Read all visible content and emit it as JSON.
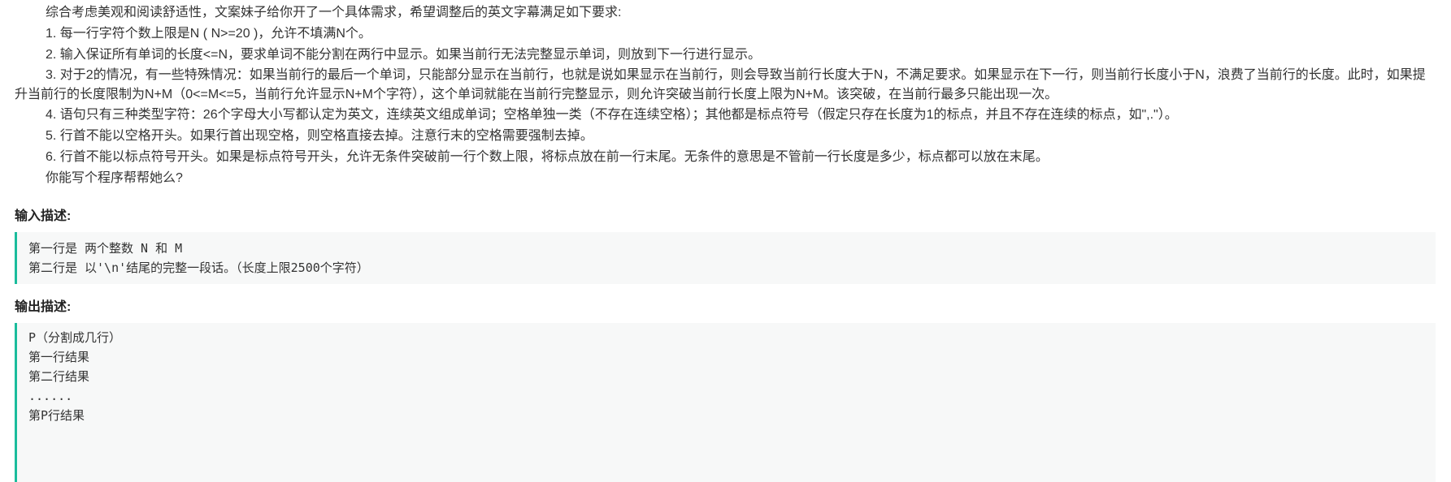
{
  "intro": {
    "lead": "综合考虑美观和阅读舒适性，文案妹子给你开了一个具体需求，希望调整后的英文字幕满足如下要求:",
    "rules": [
      "1. 每一行字符个数上限是N ( N>=20 )，允许不填满N个。",
      "2. 输入保证所有单词的长度<=N，要求单词不能分割在两行中显示。如果当前行无法完整显示单词，则放到下一行进行显示。",
      "3. 对于2的情况，有一些特殊情况：如果当前行的最后一个单词，只能部分显示在当前行，也就是说如果显示在当前行，则会导致当前行长度大于N，不满足要求。如果显示在下一行，则当前行长度小于N，浪费了当前行的长度。此时，如果提升当前行的长度限制为N+M（0<=M<=5，当前行允许显示N+M个字符），这个单词就能在当前行完整显示，则允许突破当前行长度上限为N+M。该突破，在当前行最多只能出现一次。",
      "4. 语句只有三种类型字符：26个字母大小写都认定为英文，连续英文组成单词；空格单独一类（不存在连续空格）；其他都是标点符号（假定只存在长度为1的标点，并且不存在连续的标点，如\",.\"）。",
      "5. 行首不能以空格开头。如果行首出现空格，则空格直接去掉。注意行末的空格需要强制去掉。",
      "6. 行首不能以标点符号开头。如果是标点符号开头，允许无条件突破前一行个数上限，将标点放在前一行末尾。无条件的意思是不管前一行长度是多少，标点都可以放在末尾。"
    ],
    "closing": "你能写个程序帮帮她么?"
  },
  "input_section": {
    "title": "输入描述:",
    "lines": [
      "第一行是 两个整数 N 和 M",
      "第二行是 以'\\n'结尾的完整一段话。（长度上限2500个字符）"
    ]
  },
  "output_section": {
    "title": "输出描述:",
    "lines": [
      "P（分割成几行）",
      "第一行结果",
      "第二行结果",
      "......",
      "第P行结果"
    ]
  },
  "colors": {
    "accent": "#1abc9c",
    "code_bg": "#f7f8f8",
    "text": "#333333"
  }
}
